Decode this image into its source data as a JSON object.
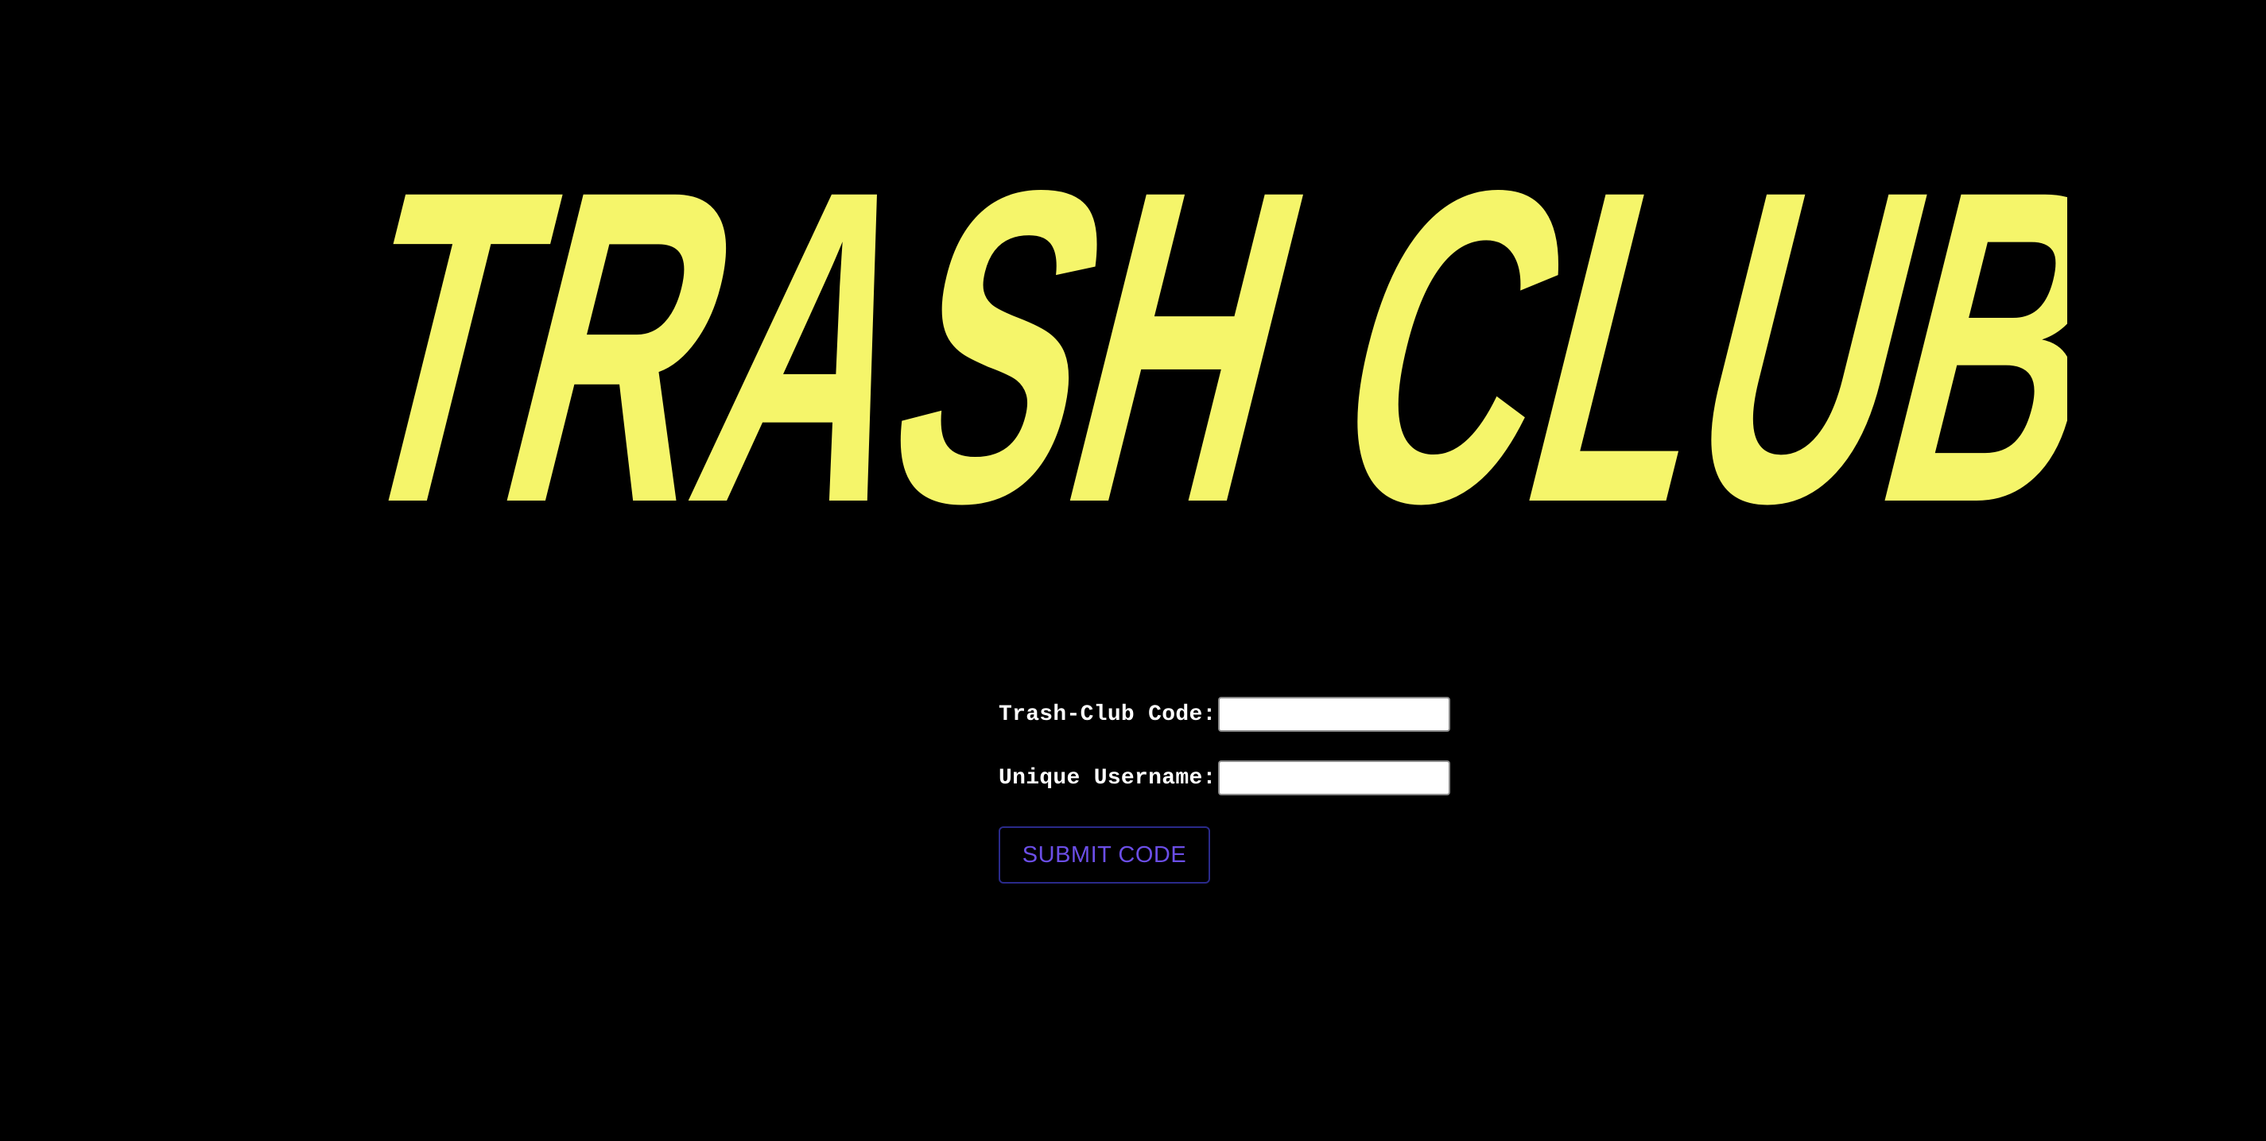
{
  "logo": {
    "text": "TRASH CLUB",
    "color": "#f5f56a"
  },
  "form": {
    "code_label": "Trash-Club Code:",
    "code_value": "",
    "username_label": "Unique Username:",
    "username_value": "",
    "submit_label": "SUBMIT CODE"
  },
  "colors": {
    "background": "#000000",
    "label_text": "#ffffff",
    "button_text": "#6b4ee6",
    "button_border": "#2a2a8a"
  }
}
